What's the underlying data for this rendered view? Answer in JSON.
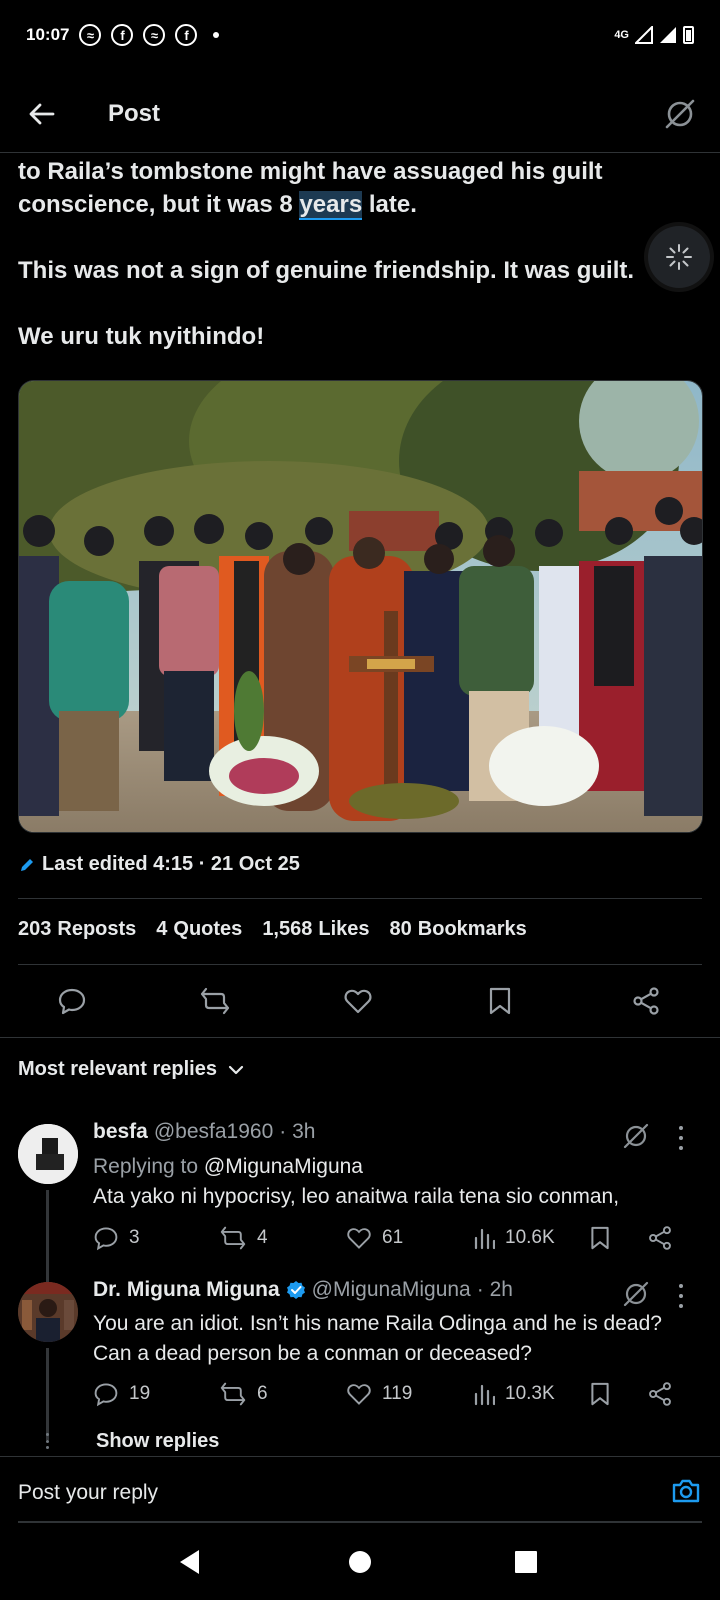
{
  "status_bar": {
    "time": "10:07",
    "network": "4G",
    "notification_icons": [
      "messenger-icon",
      "facebook-icon",
      "messenger-icon",
      "facebook-icon"
    ]
  },
  "header": {
    "title": "Post"
  },
  "post": {
    "text_line1_a": "to Raila’s tombstone might have assuaged his guilt",
    "text_line2_a": "conscience, but it was 8 ",
    "text_highlight": "years",
    "text_line2_b": " late.",
    "text_p2": "This was not a sign of genuine friendship. It was guilt.",
    "text_p3": "We uru tuk nyithindo!",
    "edited": "Last edited 4:15 · 21 Oct 25",
    "stats": [
      {
        "num": "203",
        "label": "Reposts"
      },
      {
        "num": "4",
        "label": "Quotes"
      },
      {
        "num": "1,568",
        "label": "Likes"
      },
      {
        "num": "80",
        "label": "Bookmarks"
      }
    ]
  },
  "replies_sort": "Most relevant replies",
  "replies": [
    {
      "name": "besfa",
      "handle": "@besfa1960",
      "time": "· 3h",
      "replying_to_prefix": "Replying to ",
      "replying_to": "@MigunaMiguna",
      "text": "Ata yako ni hypocrisy, leo anaitwa raila tena sio conman,",
      "replies": "3",
      "reposts": "4",
      "likes": "61",
      "views": "10.6K"
    },
    {
      "name": "Dr. Miguna Miguna",
      "handle": "@MigunaMiguna",
      "time": "· 2h",
      "text_line1": "You are an idiot. Isn’t his name Raila Odinga and he is dead?",
      "text_line2": "Can a dead person be a conman or deceased?",
      "replies": "19",
      "reposts": "6",
      "likes": "119",
      "views": "10.3K"
    }
  ],
  "show_replies": "Show replies",
  "compose": {
    "placeholder": "Post your reply"
  },
  "colors": {
    "accent": "#1d9bf0",
    "text": "#e7e9ea",
    "muted": "#9aa0a6",
    "divider": "#2f3336"
  }
}
